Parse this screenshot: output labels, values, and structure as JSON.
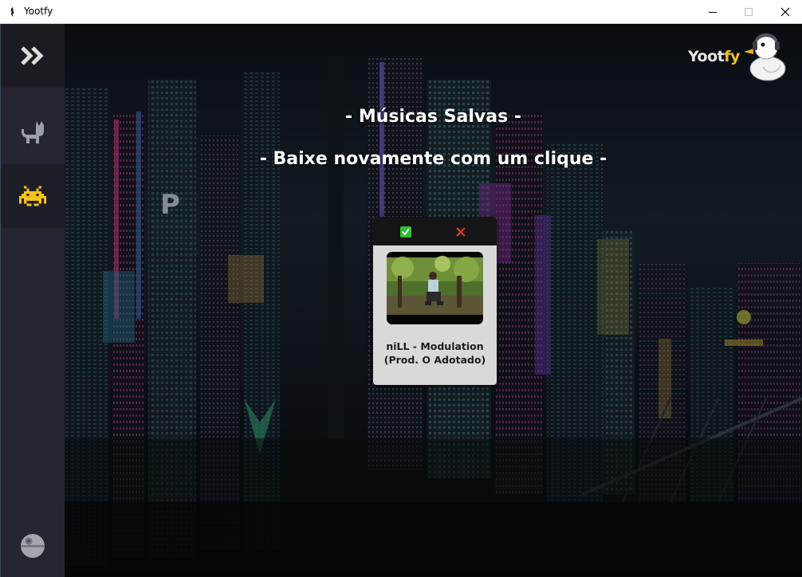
{
  "window": {
    "title": "Yootfy"
  },
  "sidebar": {
    "toggle_icon": "double-chevron-right-icon",
    "items": [
      {
        "id": "cat",
        "icon": "cat-icon"
      },
      {
        "id": "saved",
        "icon": "space-invader-icon",
        "color": "#f2c21b"
      }
    ],
    "bottom_icon": "death-star-icon"
  },
  "logo": {
    "text_main": "Yoot",
    "text_accent": "fy",
    "accent_color": "#f2c21b",
    "icon": "duck-headphones-icon"
  },
  "main": {
    "title": "- Músicas Salvas -",
    "subtitle": "- Baixe novamente com um clique -"
  },
  "cards": [
    {
      "title_line1": "niLL - Modulation",
      "title_line2": "(Prod. O Adotado)",
      "confirm_icon": "check-icon",
      "remove_icon": "close-icon"
    }
  ],
  "colors": {
    "sidebar_bg": "#262632",
    "card_bg": "#d9d9d9",
    "confirm": "#2fbf2f",
    "remove": "#e0392b"
  }
}
